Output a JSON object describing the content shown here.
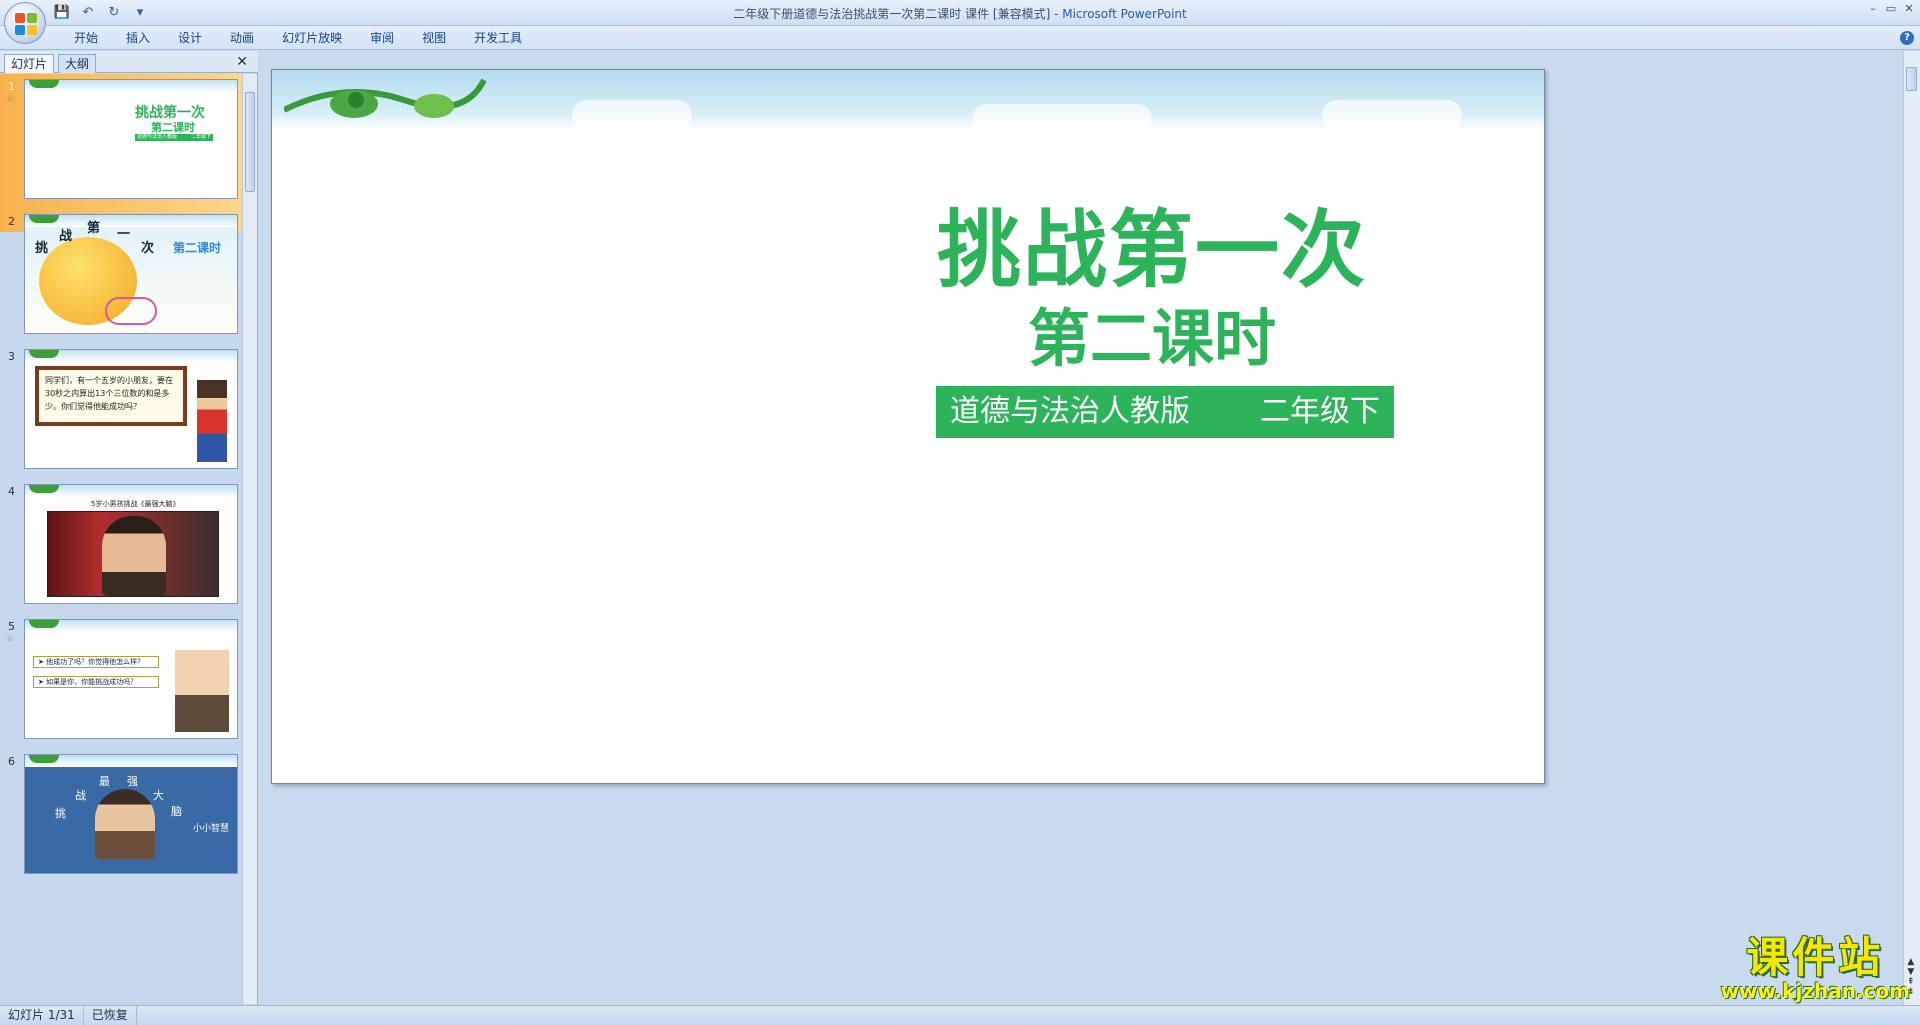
{
  "window": {
    "title": "二年级下册道德与法治挑战第一次第二课时 课件 [兼容模式] - ",
    "app_name": "Microsoft PowerPoint",
    "controls": [
      "–",
      "▭",
      "✕"
    ]
  },
  "quick_access": [
    {
      "name": "save-icon",
      "glyph": "💾"
    },
    {
      "name": "undo-icon",
      "glyph": "↶"
    },
    {
      "name": "redo-icon",
      "glyph": "↻"
    },
    {
      "name": "customize-icon",
      "glyph": "▾"
    }
  ],
  "ribbon": {
    "tabs": [
      "开始",
      "插入",
      "设计",
      "动画",
      "幻灯片放映",
      "审阅",
      "视图",
      "开发工具"
    ],
    "help": "?"
  },
  "left_panel": {
    "tab_slides": "幻灯片",
    "tab_outline": "大纲",
    "close": "✕",
    "thumbnails": [
      {
        "num": "1",
        "title": "挑战第一次",
        "subtitle": "第二课时",
        "band_left": "道德与法治人教版",
        "band_right": "二年级下"
      },
      {
        "num": "2",
        "chars": [
          "挑",
          "战",
          "第",
          "一",
          "次"
        ],
        "label": "第二课时"
      },
      {
        "num": "3",
        "text": "同学们，有一个五岁的小朋友，要在30秒之内算出13个三位数的和是多少。你们觉得他能成功吗？"
      },
      {
        "num": "4",
        "caption": "5岁小男孩挑战《最强大脑》"
      },
      {
        "num": "5",
        "items": [
          "他成功了吗？你觉得他怎么样？",
          "如果是你，你能挑战成功吗？"
        ]
      },
      {
        "num": "6",
        "chars": [
          "最",
          "强",
          "战",
          "大",
          "挑",
          "脑"
        ],
        "footer": "小小智慧"
      }
    ]
  },
  "slide": {
    "title": "挑战第一次",
    "subtitle": "第二课时",
    "band_left": "道德与法治人教版",
    "band_right": "二年级下"
  },
  "watermark": {
    "cn": "课件站",
    "url": "www.kjzhan.com"
  },
  "status": {
    "slide_info": "幻灯片 1/31",
    "state": "已恢复"
  },
  "colors": {
    "accent_green": "#2db45b",
    "selected_thumb": "#f7b24b"
  }
}
